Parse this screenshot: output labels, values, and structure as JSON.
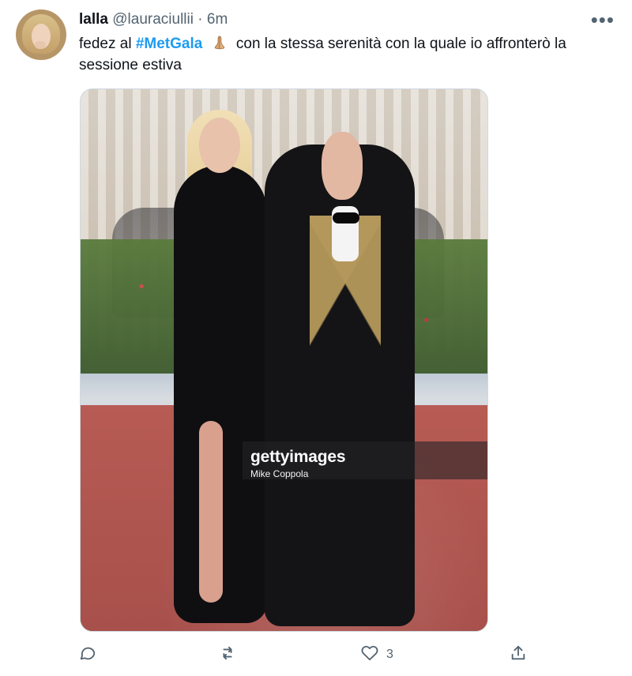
{
  "tweet": {
    "author": {
      "name": "lalla",
      "handle": "@lauraciullii",
      "separator": "·",
      "time": "6m"
    },
    "text": {
      "part1": "fedez al ",
      "hashtag": "#MetGala",
      "part2": " con la stessa serenità con la quale io affronterò la sessione estiva"
    },
    "more_label": "•••",
    "media": {
      "watermark_brand": "gettyimages",
      "watermark_credit": "Mike Coppola"
    },
    "actions": {
      "reply_count": "",
      "retweet_count": "",
      "like_count": "3",
      "share_count": ""
    }
  },
  "icons": {
    "reply": "reply-icon",
    "retweet": "retweet-icon",
    "like": "heart-icon",
    "share": "share-icon",
    "emoji": "praying-hands-emoji"
  },
  "colors": {
    "text": "#0f1419",
    "secondary": "#536471",
    "link": "#1d9bf0",
    "border": "#cfd9de"
  }
}
